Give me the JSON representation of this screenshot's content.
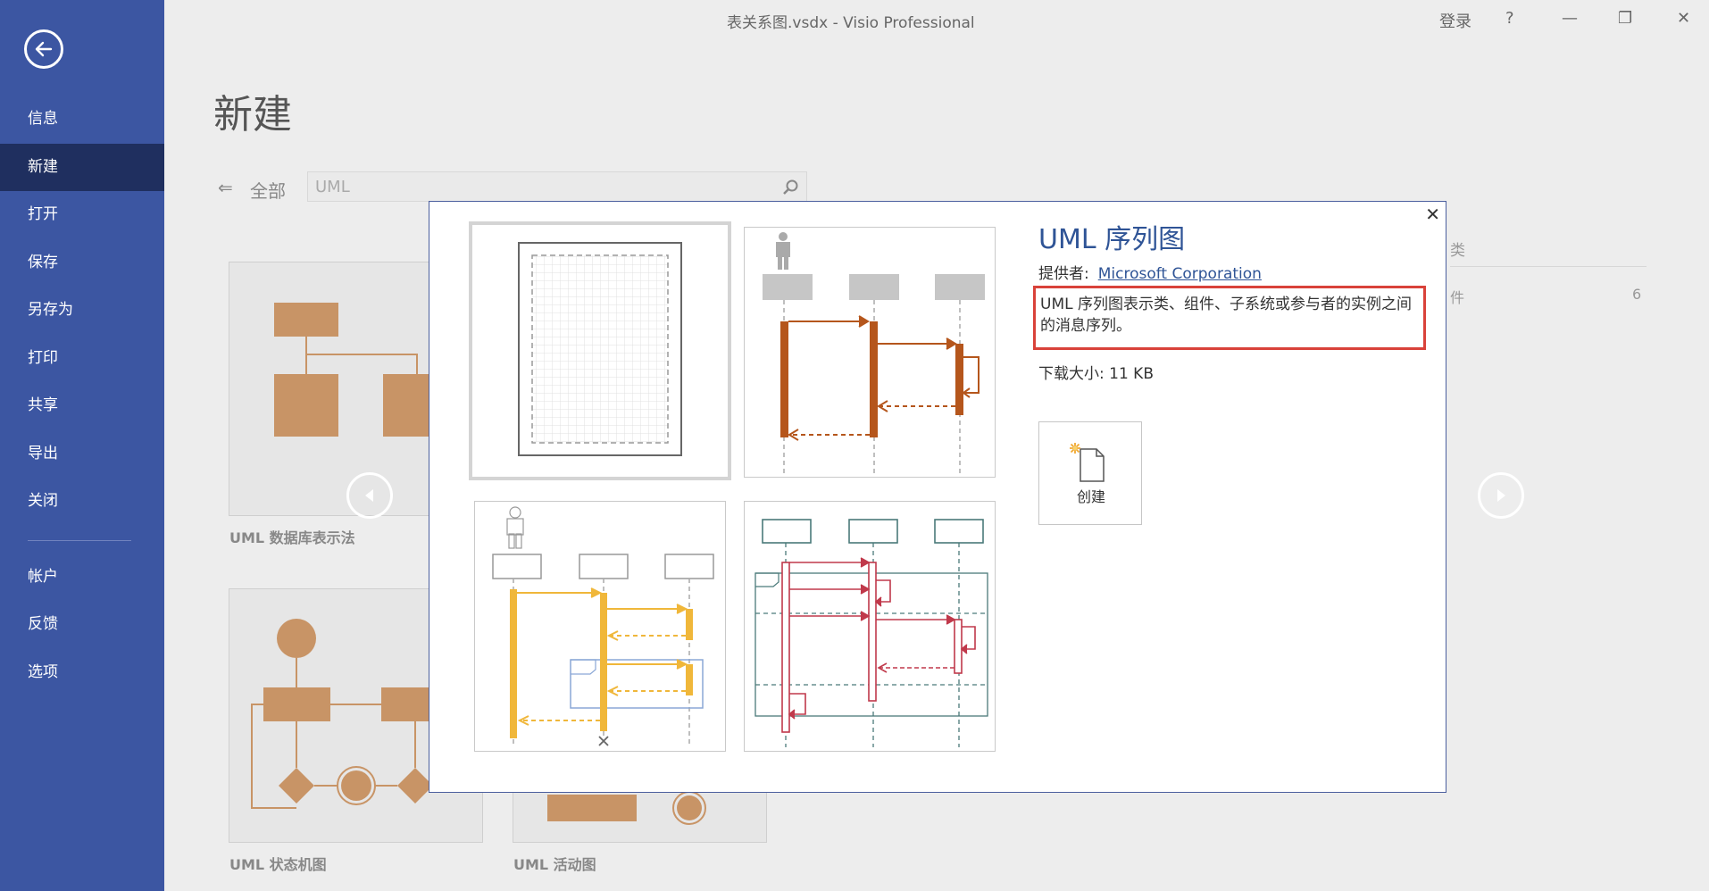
{
  "window": {
    "title": "表关系图.vsdx  -  Visio Professional",
    "signin": "登录",
    "help": "?",
    "minimize": "—",
    "restore": "❐",
    "close": "✕"
  },
  "sidebar": {
    "items": [
      {
        "label": "信息"
      },
      {
        "label": "新建"
      },
      {
        "label": "打开"
      },
      {
        "label": "保存"
      },
      {
        "label": "另存为"
      },
      {
        "label": "打印"
      },
      {
        "label": "共享"
      },
      {
        "label": "导出"
      },
      {
        "label": "关闭"
      },
      {
        "label": "帐户"
      },
      {
        "label": "反馈"
      },
      {
        "label": "选项"
      }
    ],
    "active_index": 1
  },
  "main": {
    "heading": "新建",
    "search_scope": "全部",
    "search_value": "UML",
    "tiles": [
      {
        "label": "UML 数据库表示法"
      },
      {
        "label": "UML 状态机图"
      },
      {
        "label": "UML 活动图"
      }
    ],
    "right_fragment_1": "类",
    "right_fragment_2": "件",
    "right_count": "6"
  },
  "dialog": {
    "title": "UML 序列图",
    "provider_label": "提供者:",
    "provider_name": "Microsoft Corporation",
    "description": "UML 序列图表示类、组件、子系统或参与者的实例之间的消息序列。",
    "download_size": "下载大小:  11 KB",
    "create_label": "创建"
  },
  "colors": {
    "sidebar": "#3c56a2",
    "sidebar_active": "#1f2f5f",
    "accent_title": "#2f5496",
    "highlight_border": "#d9423a",
    "orange": "#b5561c",
    "yellow": "#f0b73a",
    "red": "#c0394b",
    "teal": "#4a7a7a"
  }
}
